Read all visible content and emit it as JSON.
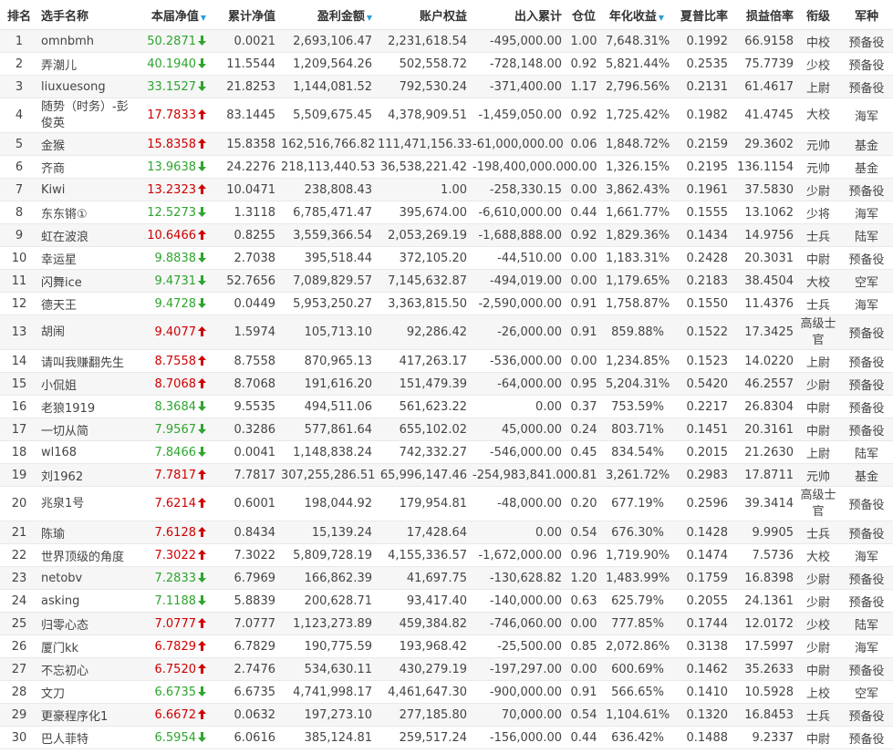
{
  "headers": {
    "rank": "排名",
    "name": "选手名称",
    "nav": "本届净值",
    "cum_nav": "累计净值",
    "profit": "盈利金额",
    "equity": "账户权益",
    "flow": "出入累计",
    "position": "仓位",
    "annual": "年化收益",
    "sharpe": "夏普比率",
    "pl_ratio": "损益倍率",
    "title": "衔级",
    "branch": "军种"
  },
  "rows": [
    {
      "rank": "1",
      "name": "omnbmh",
      "nav": "50.2871",
      "trend": "down",
      "cum_nav": "0.0021",
      "profit": "2,693,106.47",
      "equity": "2,231,618.54",
      "flow": "-495,000.00",
      "position": "1.00",
      "annual": "7,648.31%",
      "sharpe": "0.1992",
      "pl_ratio": "66.9158",
      "title": "中校",
      "branch": "预备役"
    },
    {
      "rank": "2",
      "name": "弄潮儿",
      "nav": "40.1940",
      "trend": "down",
      "cum_nav": "11.5544",
      "profit": "1,209,564.26",
      "equity": "502,558.72",
      "flow": "-728,148.00",
      "position": "0.92",
      "annual": "5,821.44%",
      "sharpe": "0.2535",
      "pl_ratio": "75.7739",
      "title": "少校",
      "branch": "预备役"
    },
    {
      "rank": "3",
      "name": "liuxuesong",
      "nav": "33.1527",
      "trend": "down",
      "cum_nav": "21.8253",
      "profit": "1,144,081.52",
      "equity": "792,530.24",
      "flow": "-371,400.00",
      "position": "1.17",
      "annual": "2,796.56%",
      "sharpe": "0.2131",
      "pl_ratio": "61.4617",
      "title": "上尉",
      "branch": "预备役"
    },
    {
      "rank": "4",
      "name": "随势（时务）-彭俊英",
      "nav": "17.7833",
      "trend": "up",
      "cum_nav": "83.1445",
      "profit": "5,509,675.45",
      "equity": "4,378,909.51",
      "flow": "-1,459,050.00",
      "position": "0.92",
      "annual": "1,725.42%",
      "sharpe": "0.1982",
      "pl_ratio": "41.4745",
      "title": "大校",
      "branch": "海军"
    },
    {
      "rank": "5",
      "name": "金猴",
      "nav": "15.8358",
      "trend": "up",
      "cum_nav": "15.8358",
      "profit": "162,516,766.82",
      "equity": "111,471,156.33",
      "flow": "-61,000,000.00",
      "position": "0.06",
      "annual": "1,848.72%",
      "sharpe": "0.2159",
      "pl_ratio": "29.3602",
      "title": "元帅",
      "branch": "基金"
    },
    {
      "rank": "6",
      "name": "齐商",
      "nav": "13.9638",
      "trend": "down",
      "cum_nav": "24.2276",
      "profit": "218,113,440.53",
      "equity": "36,538,221.42",
      "flow": "-198,400,000.00",
      "position": "0.00",
      "annual": "1,326.15%",
      "sharpe": "0.2195",
      "pl_ratio": "136.1154",
      "title": "元帅",
      "branch": "基金"
    },
    {
      "rank": "7",
      "name": "Kiwi",
      "nav": "13.2323",
      "trend": "up",
      "cum_nav": "10.0471",
      "profit": "238,808.43",
      "equity": "1.00",
      "flow": "-258,330.15",
      "position": "0.00",
      "annual": "3,862.43%",
      "sharpe": "0.1961",
      "pl_ratio": "37.5830",
      "title": "少尉",
      "branch": "预备役"
    },
    {
      "rank": "8",
      "name": "东东锵①",
      "nav": "12.5273",
      "trend": "down",
      "cum_nav": "1.3118",
      "profit": "6,785,471.47",
      "equity": "395,674.00",
      "flow": "-6,610,000.00",
      "position": "0.44",
      "annual": "1,661.77%",
      "sharpe": "0.1555",
      "pl_ratio": "13.1062",
      "title": "少将",
      "branch": "海军"
    },
    {
      "rank": "9",
      "name": "虹在波浪",
      "nav": "10.6466",
      "trend": "up",
      "cum_nav": "0.8255",
      "profit": "3,559,366.54",
      "equity": "2,053,269.19",
      "flow": "-1,688,888.00",
      "position": "0.92",
      "annual": "1,829.36%",
      "sharpe": "0.1434",
      "pl_ratio": "14.9756",
      "title": "士兵",
      "branch": "陆军"
    },
    {
      "rank": "10",
      "name": "幸运星",
      "nav": "9.8838",
      "trend": "down",
      "cum_nav": "2.7038",
      "profit": "395,518.44",
      "equity": "372,105.20",
      "flow": "-44,510.00",
      "position": "0.00",
      "annual": "1,183.31%",
      "sharpe": "0.2428",
      "pl_ratio": "20.3031",
      "title": "中尉",
      "branch": "预备役"
    },
    {
      "rank": "11",
      "name": "闪舞ice",
      "nav": "9.4731",
      "trend": "down",
      "cum_nav": "52.7656",
      "profit": "7,089,829.57",
      "equity": "7,145,632.87",
      "flow": "-494,019.00",
      "position": "0.00",
      "annual": "1,179.65%",
      "sharpe": "0.2183",
      "pl_ratio": "38.4504",
      "title": "大校",
      "branch": "空军"
    },
    {
      "rank": "12",
      "name": "德天王",
      "nav": "9.4728",
      "trend": "down",
      "cum_nav": "0.0449",
      "profit": "5,953,250.27",
      "equity": "3,363,815.50",
      "flow": "-2,590,000.00",
      "position": "0.91",
      "annual": "1,758.87%",
      "sharpe": "0.1550",
      "pl_ratio": "11.4376",
      "title": "士兵",
      "branch": "海军"
    },
    {
      "rank": "13",
      "name": "胡闹",
      "nav": "9.4077",
      "trend": "up",
      "cum_nav": "1.5974",
      "profit": "105,713.10",
      "equity": "92,286.42",
      "flow": "-26,000.00",
      "position": "0.91",
      "annual": "859.88%",
      "sharpe": "0.1522",
      "pl_ratio": "17.3425",
      "title": "高级士官",
      "branch": "预备役"
    },
    {
      "rank": "14",
      "name": "请叫我赚翻先生",
      "nav": "8.7558",
      "trend": "up",
      "cum_nav": "8.7558",
      "profit": "870,965.13",
      "equity": "417,263.17",
      "flow": "-536,000.00",
      "position": "0.00",
      "annual": "1,234.85%",
      "sharpe": "0.1523",
      "pl_ratio": "14.0220",
      "title": "上尉",
      "branch": "预备役"
    },
    {
      "rank": "15",
      "name": "小侃姐",
      "nav": "8.7068",
      "trend": "up",
      "cum_nav": "8.7068",
      "profit": "191,616.20",
      "equity": "151,479.39",
      "flow": "-64,000.00",
      "position": "0.95",
      "annual": "5,204.31%",
      "sharpe": "0.5420",
      "pl_ratio": "46.2557",
      "title": "少尉",
      "branch": "预备役"
    },
    {
      "rank": "16",
      "name": "老狼1919",
      "nav": "8.3684",
      "trend": "down",
      "cum_nav": "9.5535",
      "profit": "494,511.06",
      "equity": "561,623.22",
      "flow": "0.00",
      "position": "0.37",
      "annual": "753.59%",
      "sharpe": "0.2217",
      "pl_ratio": "26.8304",
      "title": "中尉",
      "branch": "预备役"
    },
    {
      "rank": "17",
      "name": "一切从简",
      "nav": "7.9567",
      "trend": "down",
      "cum_nav": "0.3286",
      "profit": "577,861.64",
      "equity": "655,102.02",
      "flow": "45,000.00",
      "position": "0.24",
      "annual": "803.71%",
      "sharpe": "0.1451",
      "pl_ratio": "20.3161",
      "title": "中尉",
      "branch": "预备役"
    },
    {
      "rank": "18",
      "name": "wl168",
      "nav": "7.8466",
      "trend": "down",
      "cum_nav": "0.0041",
      "profit": "1,148,838.24",
      "equity": "742,332.27",
      "flow": "-546,000.00",
      "position": "0.45",
      "annual": "834.54%",
      "sharpe": "0.2015",
      "pl_ratio": "21.2630",
      "title": "上尉",
      "branch": "陆军"
    },
    {
      "rank": "19",
      "name": "刘1962",
      "nav": "7.7817",
      "trend": "up",
      "cum_nav": "7.7817",
      "profit": "307,255,286.51",
      "equity": "65,996,147.46",
      "flow": "-254,983,841.00",
      "position": "0.81",
      "annual": "3,261.72%",
      "sharpe": "0.2983",
      "pl_ratio": "17.8711",
      "title": "元帅",
      "branch": "基金"
    },
    {
      "rank": "20",
      "name": "兆泉1号",
      "nav": "7.6214",
      "trend": "up",
      "cum_nav": "0.6001",
      "profit": "198,044.92",
      "equity": "179,954.81",
      "flow": "-48,000.00",
      "position": "0.20",
      "annual": "677.19%",
      "sharpe": "0.2596",
      "pl_ratio": "39.3414",
      "title": "高级士官",
      "branch": "预备役"
    },
    {
      "rank": "21",
      "name": "陈瑜",
      "nav": "7.6128",
      "trend": "up",
      "cum_nav": "0.8434",
      "profit": "15,139.24",
      "equity": "17,428.64",
      "flow": "0.00",
      "position": "0.54",
      "annual": "676.30%",
      "sharpe": "0.1428",
      "pl_ratio": "9.9905",
      "title": "士兵",
      "branch": "预备役"
    },
    {
      "rank": "22",
      "name": "世界顶级的角度",
      "nav": "7.3022",
      "trend": "up",
      "cum_nav": "7.3022",
      "profit": "5,809,728.19",
      "equity": "4,155,336.57",
      "flow": "-1,672,000.00",
      "position": "0.96",
      "annual": "1,719.90%",
      "sharpe": "0.1474",
      "pl_ratio": "7.5736",
      "title": "大校",
      "branch": "海军"
    },
    {
      "rank": "23",
      "name": "netobv",
      "nav": "7.2833",
      "trend": "down",
      "cum_nav": "6.7969",
      "profit": "166,862.39",
      "equity": "41,697.75",
      "flow": "-130,628.82",
      "position": "1.20",
      "annual": "1,483.99%",
      "sharpe": "0.1759",
      "pl_ratio": "16.8398",
      "title": "少尉",
      "branch": "预备役"
    },
    {
      "rank": "24",
      "name": "asking",
      "nav": "7.1188",
      "trend": "down",
      "cum_nav": "5.8839",
      "profit": "200,628.71",
      "equity": "93,417.40",
      "flow": "-140,000.00",
      "position": "0.63",
      "annual": "625.79%",
      "sharpe": "0.2055",
      "pl_ratio": "24.1361",
      "title": "少尉",
      "branch": "预备役"
    },
    {
      "rank": "25",
      "name": "归零心态",
      "nav": "7.0777",
      "trend": "up",
      "cum_nav": "7.0777",
      "profit": "1,123,273.89",
      "equity": "459,384.82",
      "flow": "-746,060.00",
      "position": "0.00",
      "annual": "777.85%",
      "sharpe": "0.1744",
      "pl_ratio": "12.0172",
      "title": "少校",
      "branch": "陆军"
    },
    {
      "rank": "26",
      "name": "厦门kk",
      "nav": "6.7829",
      "trend": "up",
      "cum_nav": "6.7829",
      "profit": "190,775.59",
      "equity": "193,968.42",
      "flow": "-25,500.00",
      "position": "0.85",
      "annual": "2,072.86%",
      "sharpe": "0.3138",
      "pl_ratio": "17.5997",
      "title": "少尉",
      "branch": "海军"
    },
    {
      "rank": "27",
      "name": "不忘初心",
      "nav": "6.7520",
      "trend": "up",
      "cum_nav": "2.7476",
      "profit": "534,630.11",
      "equity": "430,279.19",
      "flow": "-197,297.00",
      "position": "0.00",
      "annual": "600.69%",
      "sharpe": "0.1462",
      "pl_ratio": "35.2633",
      "title": "中尉",
      "branch": "预备役"
    },
    {
      "rank": "28",
      "name": "文刀",
      "nav": "6.6735",
      "trend": "down",
      "cum_nav": "6.6735",
      "profit": "4,741,998.17",
      "equity": "4,461,647.30",
      "flow": "-900,000.00",
      "position": "0.91",
      "annual": "566.65%",
      "sharpe": "0.1410",
      "pl_ratio": "10.5928",
      "title": "上校",
      "branch": "空军"
    },
    {
      "rank": "29",
      "name": "更豪程序化1",
      "nav": "6.6672",
      "trend": "up",
      "cum_nav": "0.0632",
      "profit": "197,273.10",
      "equity": "277,185.80",
      "flow": "70,000.00",
      "position": "0.54",
      "annual": "1,104.61%",
      "sharpe": "0.1320",
      "pl_ratio": "16.8453",
      "title": "士兵",
      "branch": "预备役"
    },
    {
      "rank": "30",
      "name": "巴人菲特",
      "nav": "6.5954",
      "trend": "down",
      "cum_nav": "6.0616",
      "profit": "385,124.81",
      "equity": "259,517.24",
      "flow": "-156,000.00",
      "position": "0.44",
      "annual": "636.42%",
      "sharpe": "0.1488",
      "pl_ratio": "9.2337",
      "title": "中尉",
      "branch": "预备役"
    }
  ],
  "colors": {
    "up": "#d00000",
    "down": "#2ea52e",
    "sort_indicator": "#2a9fd6",
    "stripe": "#f6f6f6"
  },
  "icons": {
    "up": "arrow-up-icon",
    "down": "arrow-down-icon",
    "sort": "sort-desc-icon"
  }
}
